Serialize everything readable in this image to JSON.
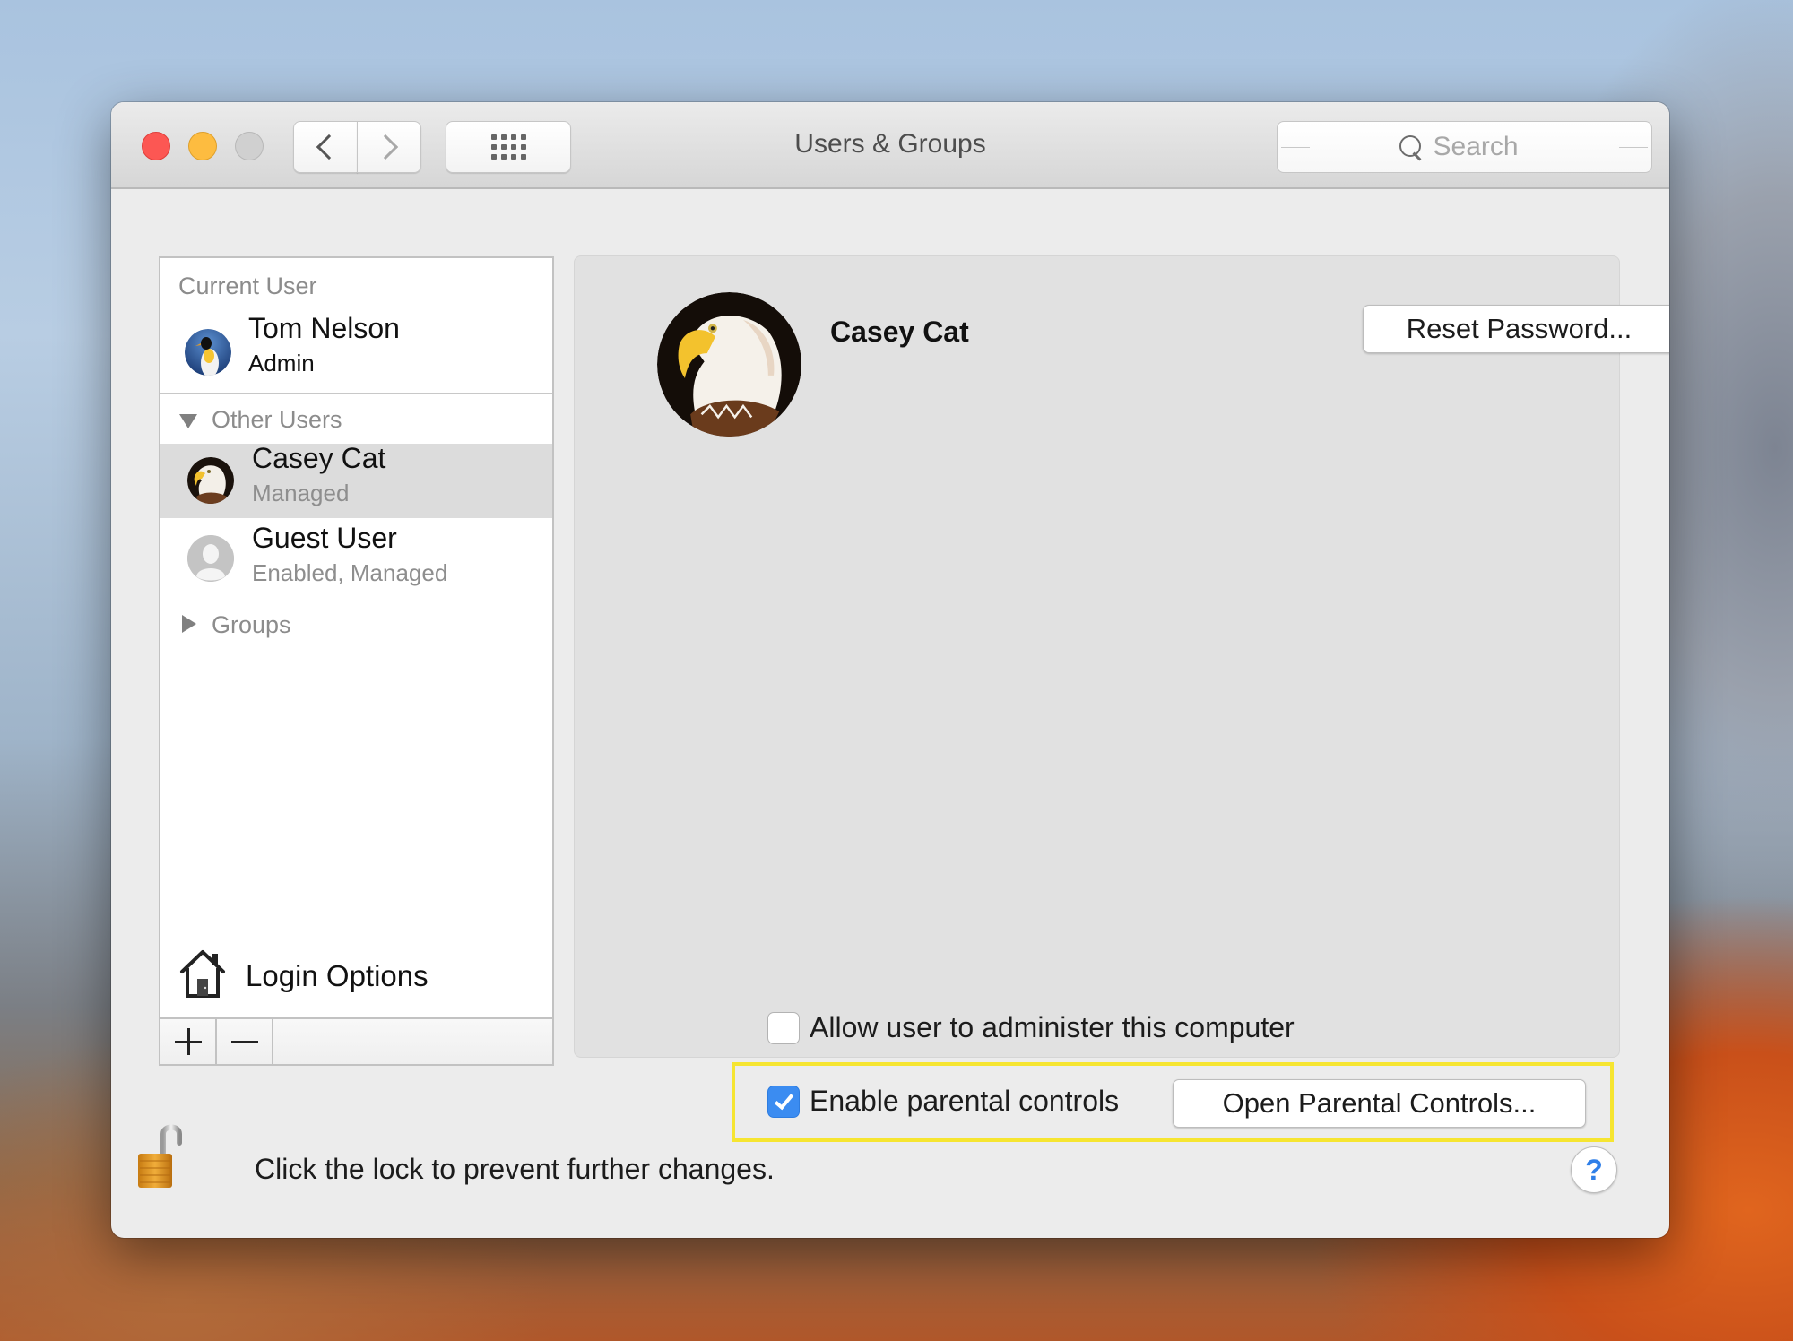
{
  "window": {
    "title": "Users & Groups",
    "traffic_lights": {
      "close_color": "#fc5753",
      "minimize_color": "#fdbc40",
      "zoom_color": "#d0d0d0"
    },
    "toolbar": {
      "back_icon": "chevron-left-icon",
      "forward_icon": "chevron-right-icon",
      "show_all_icon": "grid-icon"
    },
    "search": {
      "placeholder": "Search",
      "value": "",
      "icon": "search-icon"
    }
  },
  "sidebar": {
    "current_user_header": "Current User",
    "current_user": {
      "name": "Tom Nelson",
      "role": "Admin",
      "avatar": "penguin-avatar"
    },
    "other_users_header": "Other Users",
    "other_users": [
      {
        "name": "Casey Cat",
        "role": "Managed",
        "avatar": "eagle-avatar",
        "selected": true
      },
      {
        "name": "Guest User",
        "role": "Enabled, Managed",
        "avatar": "generic-user-avatar",
        "selected": false
      }
    ],
    "groups_header": "Groups",
    "login_options_label": "Login Options",
    "add_label": "+",
    "remove_label": "−"
  },
  "detail": {
    "user_name": "Casey Cat",
    "reset_password_label": "Reset Password...",
    "allow_admin": {
      "label": "Allow user to administer this computer",
      "checked": false
    },
    "parental_controls": {
      "label": "Enable parental controls",
      "checked": true
    },
    "open_parental_controls_label": "Open Parental Controls...",
    "highlight_color": "#f6e531",
    "checkbox_accent": "#3b8cf1"
  },
  "footer": {
    "lock_text": "Click the lock to prevent further changes.",
    "lock_state": "unlocked",
    "help_label": "?"
  }
}
